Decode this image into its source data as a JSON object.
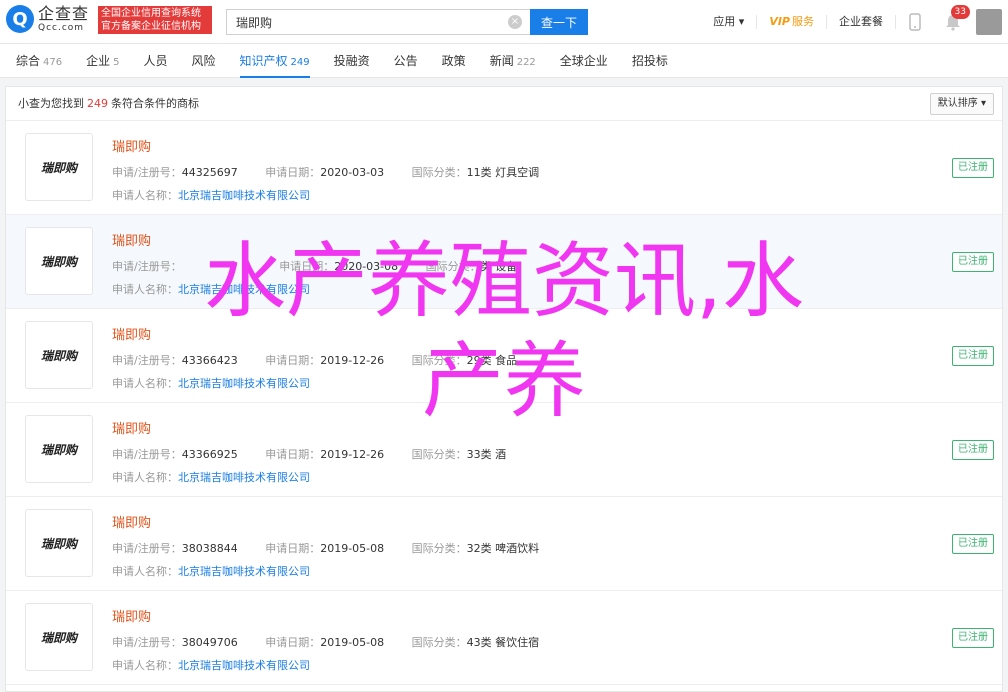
{
  "header": {
    "logo_mark": "Q",
    "logo_cn": "企查查",
    "logo_en": "Qcc.com",
    "logo_tag_line1": "全国企业信用查询系统",
    "logo_tag_line2": "官方备案企业征信机构",
    "search_value": "瑞即购",
    "clear_glyph": "×",
    "search_button": "查一下",
    "nav_app": "应用 ▾",
    "nav_vip": "VIP",
    "nav_vip_sub": "服务",
    "nav_enterprise": "企业套餐",
    "notification_count": "33"
  },
  "tabs": [
    {
      "label": "综合",
      "count": "476"
    },
    {
      "label": "企业",
      "count": "5"
    },
    {
      "label": "人员",
      "count": ""
    },
    {
      "label": "风险",
      "count": ""
    },
    {
      "label": "知识产权",
      "count": "249"
    },
    {
      "label": "投融资",
      "count": ""
    },
    {
      "label": "公告",
      "count": ""
    },
    {
      "label": "政策",
      "count": ""
    },
    {
      "label": "新闻",
      "count": "222"
    },
    {
      "label": "全球企业",
      "count": ""
    },
    {
      "label": "招投标",
      "count": ""
    }
  ],
  "summary": {
    "prefix": "小查为您找到",
    "count": "249",
    "suffix": "条符合条件的商标",
    "sort_label": "默认排序 ▾"
  },
  "labels": {
    "reg_no": "申请/注册号：",
    "date": "申请日期：",
    "class": "国际分类：",
    "owner": "申请人名称："
  },
  "results": [
    {
      "thumb": "瑞即购",
      "name": "瑞即购",
      "reg_no": "44325697",
      "date": "2020-03-03",
      "class": "11类 灯具空调",
      "owner": "北京瑞吉咖啡技术有限公司",
      "status": "已注册"
    },
    {
      "thumb": "瑞即购",
      "name": "瑞即购",
      "reg_no": "",
      "date": "2020-03-08",
      "class": "类 设备",
      "owner": "北京瑞吉咖啡技术有限公司",
      "status": "已注册"
    },
    {
      "thumb": "瑞即购",
      "name": "瑞即购",
      "reg_no": "43366423",
      "date": "2019-12-26",
      "class": "29类 食品",
      "owner": "北京瑞吉咖啡技术有限公司",
      "status": "已注册"
    },
    {
      "thumb": "瑞即购",
      "name": "瑞即购",
      "reg_no": "43366925",
      "date": "2019-12-26",
      "class": "33类 酒",
      "owner": "北京瑞吉咖啡技术有限公司",
      "status": "已注册"
    },
    {
      "thumb": "瑞即购",
      "name": "瑞即购",
      "reg_no": "38038844",
      "date": "2019-05-08",
      "class": "32类 啤酒饮料",
      "owner": "北京瑞吉咖啡技术有限公司",
      "status": "已注册"
    },
    {
      "thumb": "瑞即购",
      "name": "瑞即购",
      "reg_no": "38049706",
      "date": "2019-05-08",
      "class": "43类 餐饮住宿",
      "owner": "北京瑞吉咖啡技术有限公司",
      "status": "已注册"
    }
  ],
  "overlay": {
    "line1": "水产养殖资讯,水",
    "line2": "产养"
  },
  "colors": {
    "brand_blue": "#1a7ee8",
    "accent_red": "#e33a3a",
    "name_orange": "#e0541c",
    "status_green": "#3cb371",
    "overlay_magenta": "#f036f0"
  }
}
